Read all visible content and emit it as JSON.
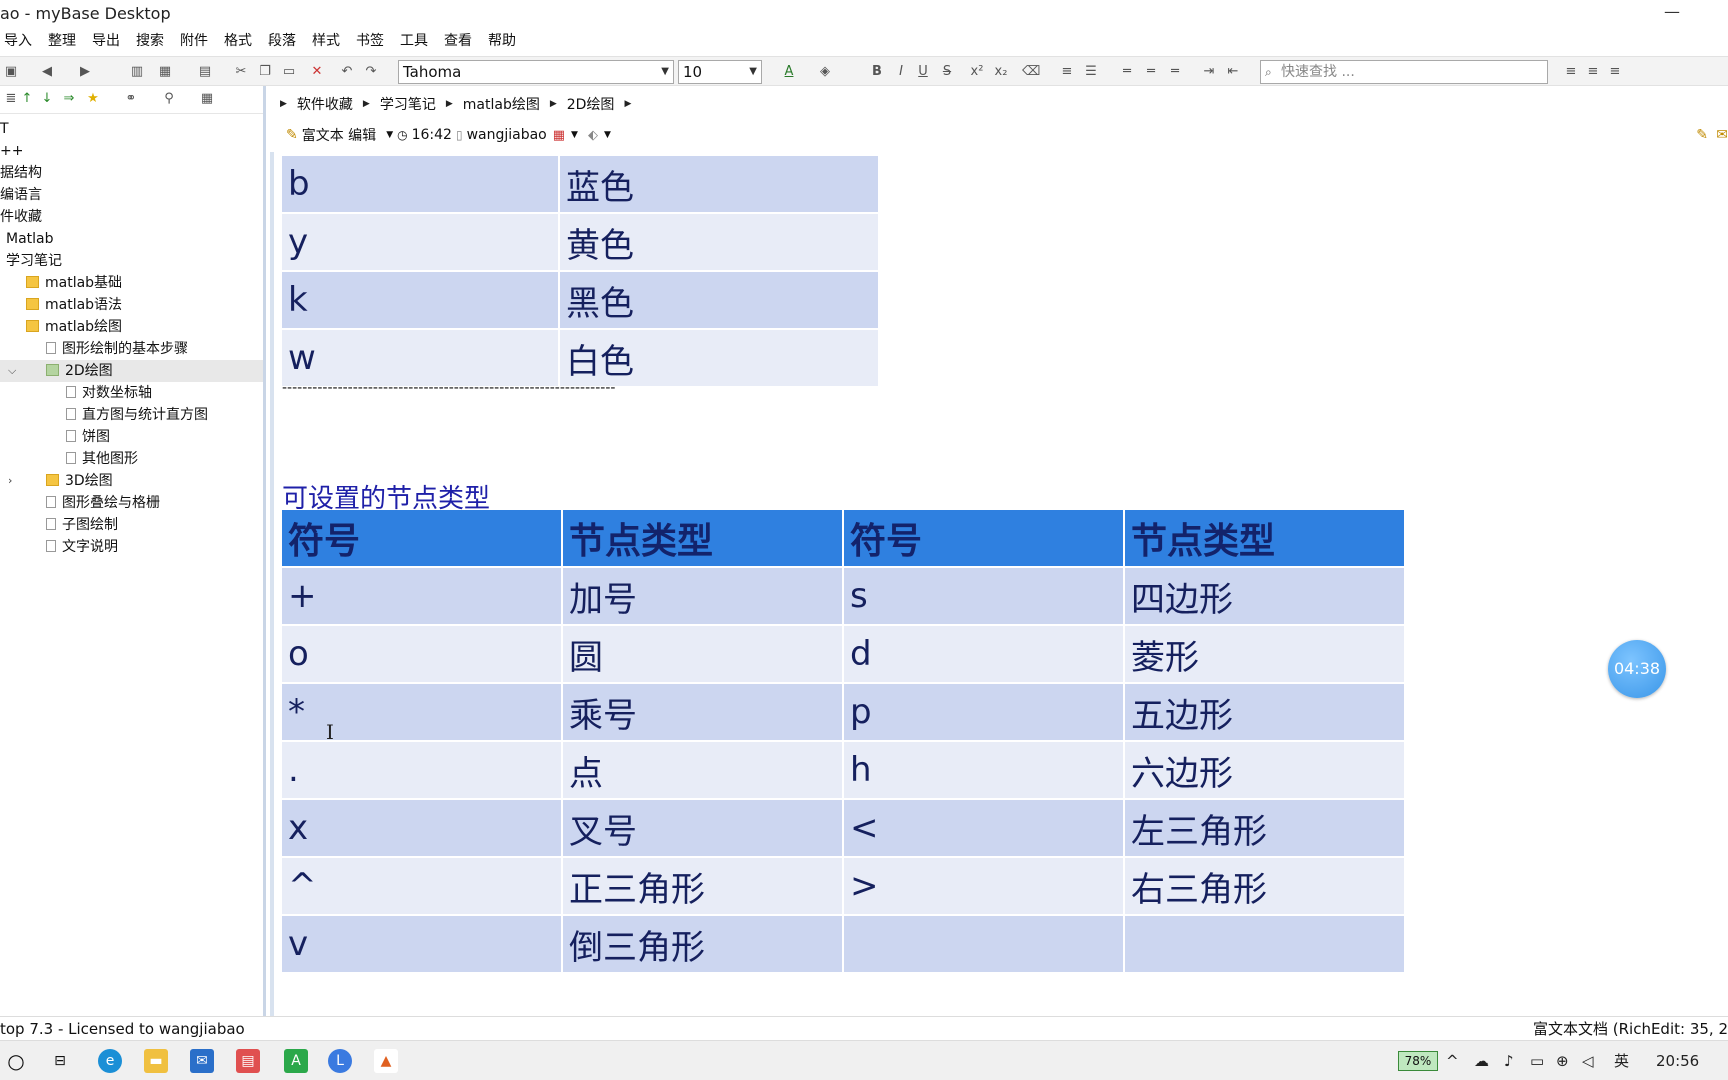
{
  "window": {
    "title": "ao - myBase Desktop",
    "minimize": "—",
    "close": "✕"
  },
  "menu": [
    "导入",
    "整理",
    "导出",
    "搜索",
    "附件",
    "格式",
    "段落",
    "样式",
    "书签",
    "工具",
    "查看",
    "帮助"
  ],
  "toolbar": {
    "font": "Tahoma",
    "size": "10",
    "search_placeholder": "快速查找 ...",
    "bold": "B",
    "italic": "I",
    "underline": "U",
    "strike": "S"
  },
  "tree": [
    {
      "label": "T",
      "indent": 0,
      "icon": "none"
    },
    {
      "label": "++",
      "indent": 0,
      "icon": "none"
    },
    {
      "label": "据结构",
      "indent": 0,
      "icon": "none"
    },
    {
      "label": "编语言",
      "indent": 0,
      "icon": "none"
    },
    {
      "label": "件收藏",
      "indent": 0,
      "icon": "none"
    },
    {
      "label": "Matlab",
      "indent": 1,
      "icon": "none"
    },
    {
      "label": "学习笔记",
      "indent": 1,
      "icon": "none"
    },
    {
      "label": "matlab基础",
      "indent": 2,
      "icon": "folder"
    },
    {
      "label": "matlab语法",
      "indent": 2,
      "icon": "folder"
    },
    {
      "label": "matlab绘图",
      "indent": 2,
      "icon": "folder"
    },
    {
      "label": "图形绘制的基本步骤",
      "indent": 3,
      "icon": "doc"
    },
    {
      "label": "2D绘图",
      "indent": 3,
      "icon": "folder-green",
      "selected": true,
      "expander": "v"
    },
    {
      "label": "对数坐标轴",
      "indent": 4,
      "icon": "doc"
    },
    {
      "label": "直方图与统计直方图",
      "indent": 4,
      "icon": "doc"
    },
    {
      "label": "饼图",
      "indent": 4,
      "icon": "doc"
    },
    {
      "label": "其他图形",
      "indent": 4,
      "icon": "doc"
    },
    {
      "label": "3D绘图",
      "indent": 3,
      "icon": "folder",
      "expander": ">"
    },
    {
      "label": "图形叠绘与格栅",
      "indent": 3,
      "icon": "doc"
    },
    {
      "label": "子图绘制",
      "indent": 3,
      "icon": "doc"
    },
    {
      "label": "文字说明",
      "indent": 3,
      "icon": "doc"
    }
  ],
  "breadcrumb": [
    "软件收藏",
    "学习笔记",
    "matlab绘图",
    "2D绘图"
  ],
  "info": {
    "editor": "富文本 编辑",
    "time": "16:42",
    "user": "wangjiabao"
  },
  "colors_table": [
    [
      "b",
      "蓝色"
    ],
    [
      "y",
      "黄色"
    ],
    [
      "k",
      "黑色"
    ],
    [
      "w",
      "白色"
    ]
  ],
  "divider": "------------------------------------------------------------------",
  "section_title": "可设置的节点类型",
  "markers_header": [
    "符号",
    "节点类型",
    "符号",
    "节点类型"
  ],
  "markers_rows": [
    [
      "+",
      "加号",
      "s",
      "四边形"
    ],
    [
      "o",
      "圆",
      "d",
      "菱形"
    ],
    [
      "*",
      "乘号",
      "p",
      "五边形"
    ],
    [
      ".",
      "点",
      "h",
      "六边形"
    ],
    [
      "x",
      "叉号",
      "<",
      "左三角形"
    ],
    [
      "^",
      "正三角形",
      ">",
      "右三角形"
    ],
    [
      "v",
      "倒三角形",
      "",
      ""
    ]
  ],
  "timer": "04:38",
  "status": {
    "left": "top 7.3 - Licensed to wangjiabao",
    "right": "富文本文档 (RichEdit: 35, 2"
  },
  "taskbar": {
    "battery": "78%",
    "ime": "英",
    "clock": "20:56"
  },
  "accent_colors": {
    "header_blue": "#2f80e0",
    "row_dark": "#ccd6f0",
    "row_light": "#e8ecf7",
    "title_blue": "#1f20a8"
  }
}
